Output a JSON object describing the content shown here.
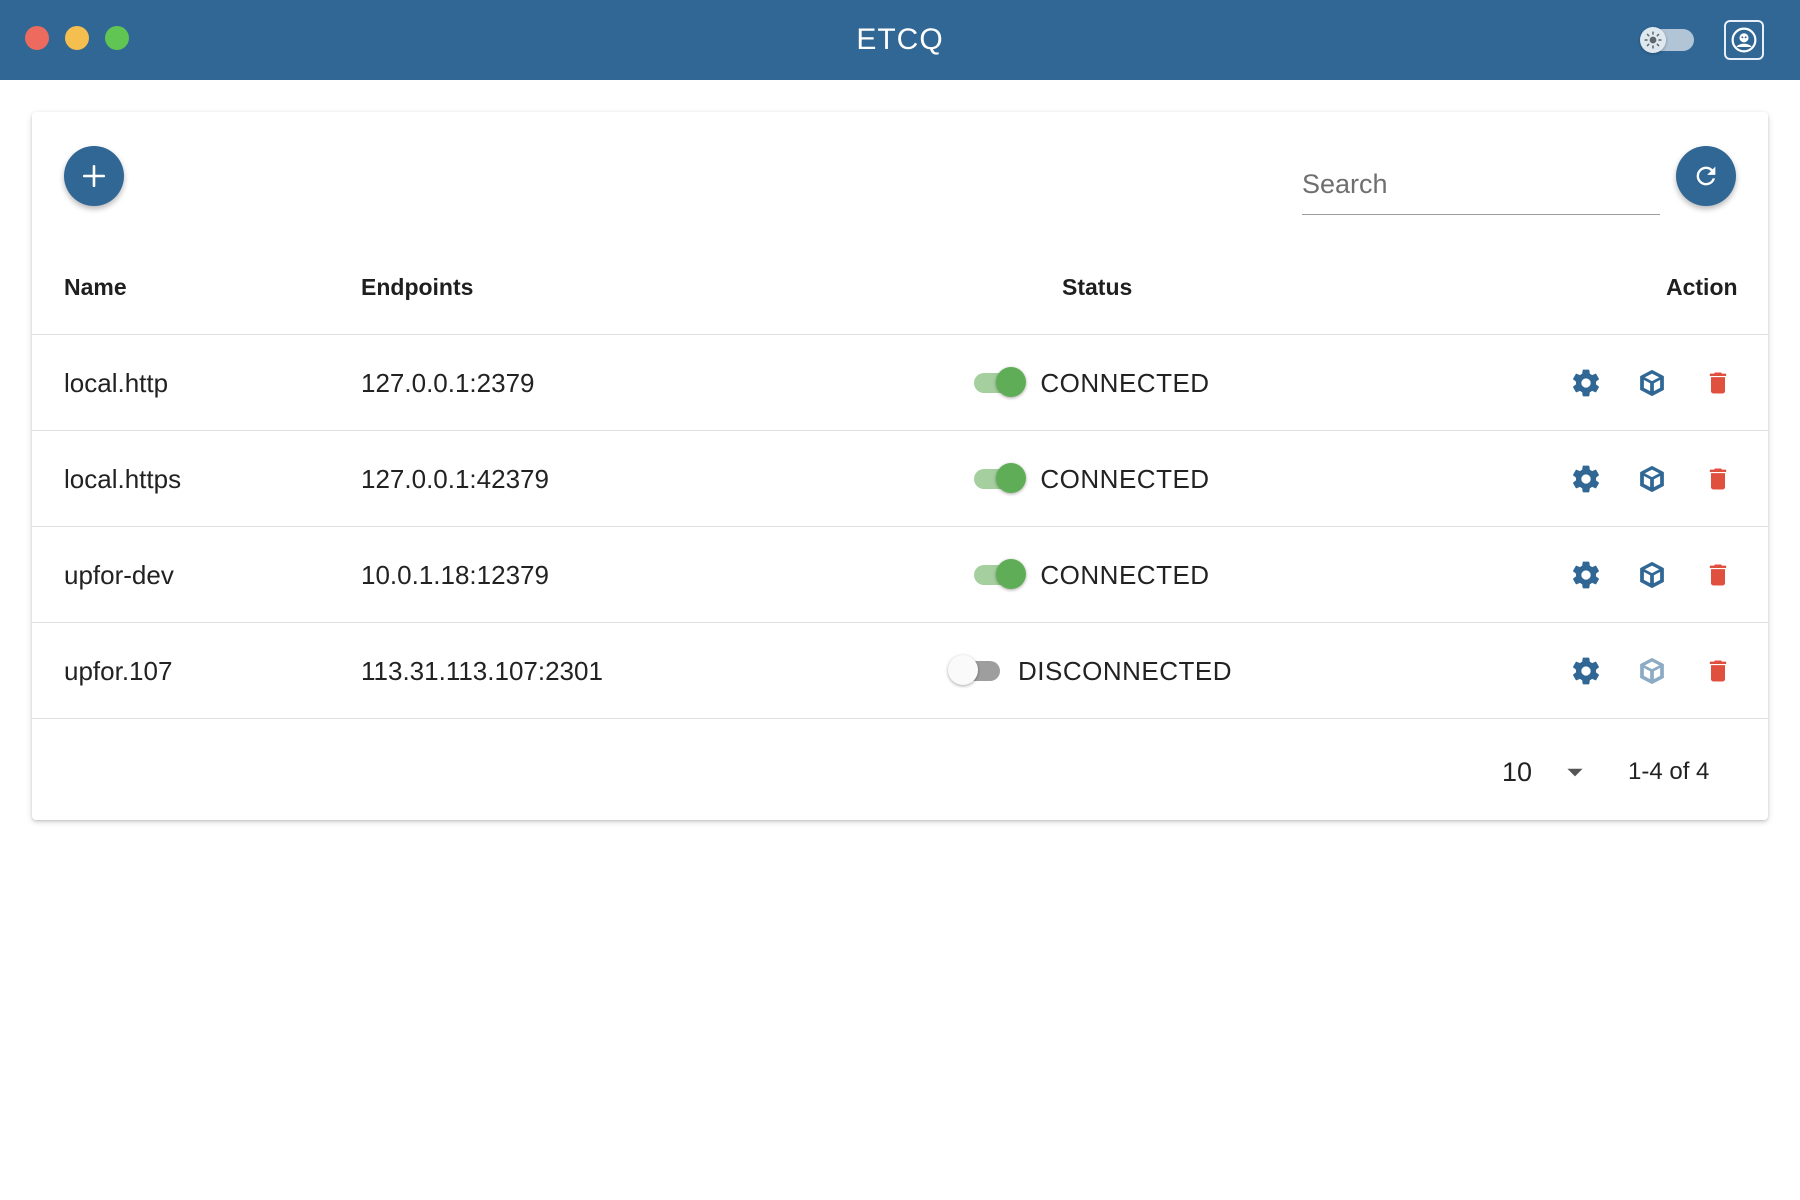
{
  "app": {
    "title": "ETCQ"
  },
  "toolbar": {
    "search_placeholder": "Search"
  },
  "table": {
    "headers": {
      "name": "Name",
      "endpoints": "Endpoints",
      "status": "Status",
      "action": "Action"
    },
    "rows": [
      {
        "name": "local.http",
        "endpoint": "127.0.0.1:2379",
        "status": "CONNECTED",
        "connected": true
      },
      {
        "name": "local.https",
        "endpoint": "127.0.0.1:42379",
        "status": "CONNECTED",
        "connected": true
      },
      {
        "name": "upfor-dev",
        "endpoint": "10.0.1.18:12379",
        "status": "CONNECTED",
        "connected": true
      },
      {
        "name": "upfor.107",
        "endpoint": "113.31.113.107:2301",
        "status": "DISCONNECTED",
        "connected": false
      }
    ]
  },
  "pagination": {
    "rows_per_page": "10",
    "range": "1-4 of 4"
  },
  "colors": {
    "primary": "#306795",
    "connected": "#5fae57",
    "danger": "#e0503f"
  },
  "icons": {
    "add": "plus-icon",
    "refresh": "refresh-icon",
    "settings": "gear-icon",
    "browse": "cube-icon",
    "delete": "trash-icon",
    "theme": "sun-icon",
    "account": "avatar-icon",
    "dropdown": "caret-down-icon"
  }
}
